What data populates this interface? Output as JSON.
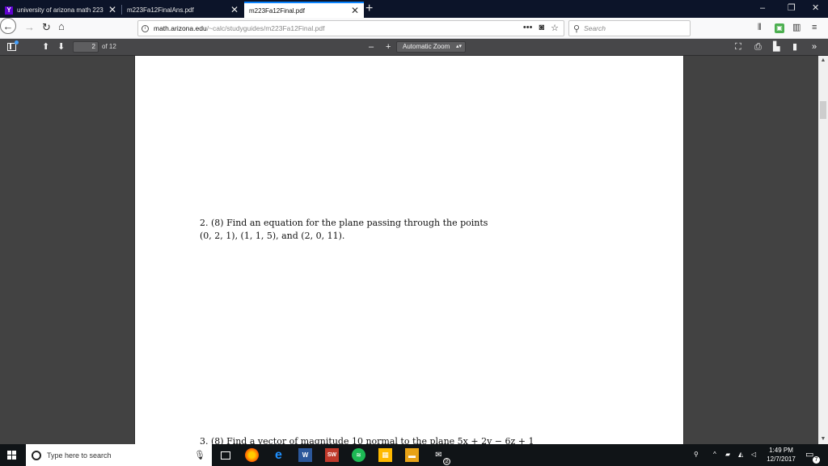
{
  "browser": {
    "tabs": [
      {
        "label": "university of arizona math 223",
        "close": "✕",
        "active": false
      },
      {
        "label": "m223Fa12FinalAns.pdf",
        "close": "✕",
        "active": false
      },
      {
        "label": "m223Fa12Final.pdf",
        "close": "✕",
        "active": true
      }
    ],
    "new_tab": "+",
    "window_controls": {
      "minimize": "–",
      "restore": "❐",
      "close": "✕"
    },
    "url": {
      "host": "math.arizona.edu",
      "path": "/~calc/studyguides/m223Fa12Final.pdf"
    },
    "url_actions": {
      "more": "•••",
      "pocket": "◙",
      "bookmark": "☆"
    },
    "search_placeholder": "Search",
    "toolbar_icons": [
      "library-icon",
      "extension-icon",
      "sidebar-icon",
      "menu-icon"
    ]
  },
  "pdf_toolbar": {
    "page_number": "2",
    "page_count": "of 12",
    "zoom_out": "–",
    "zoom_in": "+",
    "zoom_level": "Automatic Zoom",
    "more_tools": "»"
  },
  "document": {
    "problem_2": {
      "line1": "2. (8) Find an equation for the plane passing through the points",
      "line2": "(0, 2, 1), (1, 1, 5), and (2, 0, 11)."
    },
    "problem_3_partial": "3. (8) Find a vector of magnitude 10 normal to the plane 5x + 2y − 6z + 1"
  },
  "taskbar": {
    "search_placeholder": "Type here to search",
    "time": "1:49 PM",
    "date": "12/7/2017",
    "notification_count": "7",
    "spotify_badge": "2"
  }
}
